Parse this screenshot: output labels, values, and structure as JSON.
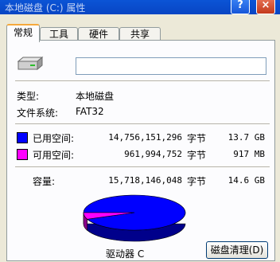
{
  "window": {
    "title": "本地磁盘 (C:) 属性",
    "help_label": "?",
    "close_label": "×"
  },
  "tabs": [
    {
      "label": "常规",
      "active": true
    },
    {
      "label": "工具",
      "active": false
    },
    {
      "label": "硬件",
      "active": false
    },
    {
      "label": "共享",
      "active": false
    }
  ],
  "general": {
    "name_value": "",
    "type_label": "类型:",
    "type_value": "本地磁盘",
    "fs_label": "文件系统:",
    "fs_value": "FAT32",
    "used": {
      "label": "已用空间:",
      "bytes": "14,756,151,296",
      "unit": "字节",
      "size": "13.7 GB",
      "color": "#0000ff"
    },
    "free": {
      "label": "可用空间:",
      "bytes": "961,994,752",
      "unit": "字节",
      "size": "917 MB",
      "color": "#ff00ff"
    },
    "capacity": {
      "label": "容量:",
      "bytes": "15,718,146,048",
      "unit": "字节",
      "size": "14.6 GB"
    },
    "drive_label": "驱动器 C",
    "cleanup_button": "磁盘清理(D)"
  },
  "chart_data": {
    "type": "pie",
    "labels": [
      "已用空间",
      "可用空间"
    ],
    "values": [
      14756151296,
      961994752
    ],
    "colors": [
      "#0000ff",
      "#ff00ff"
    ]
  }
}
